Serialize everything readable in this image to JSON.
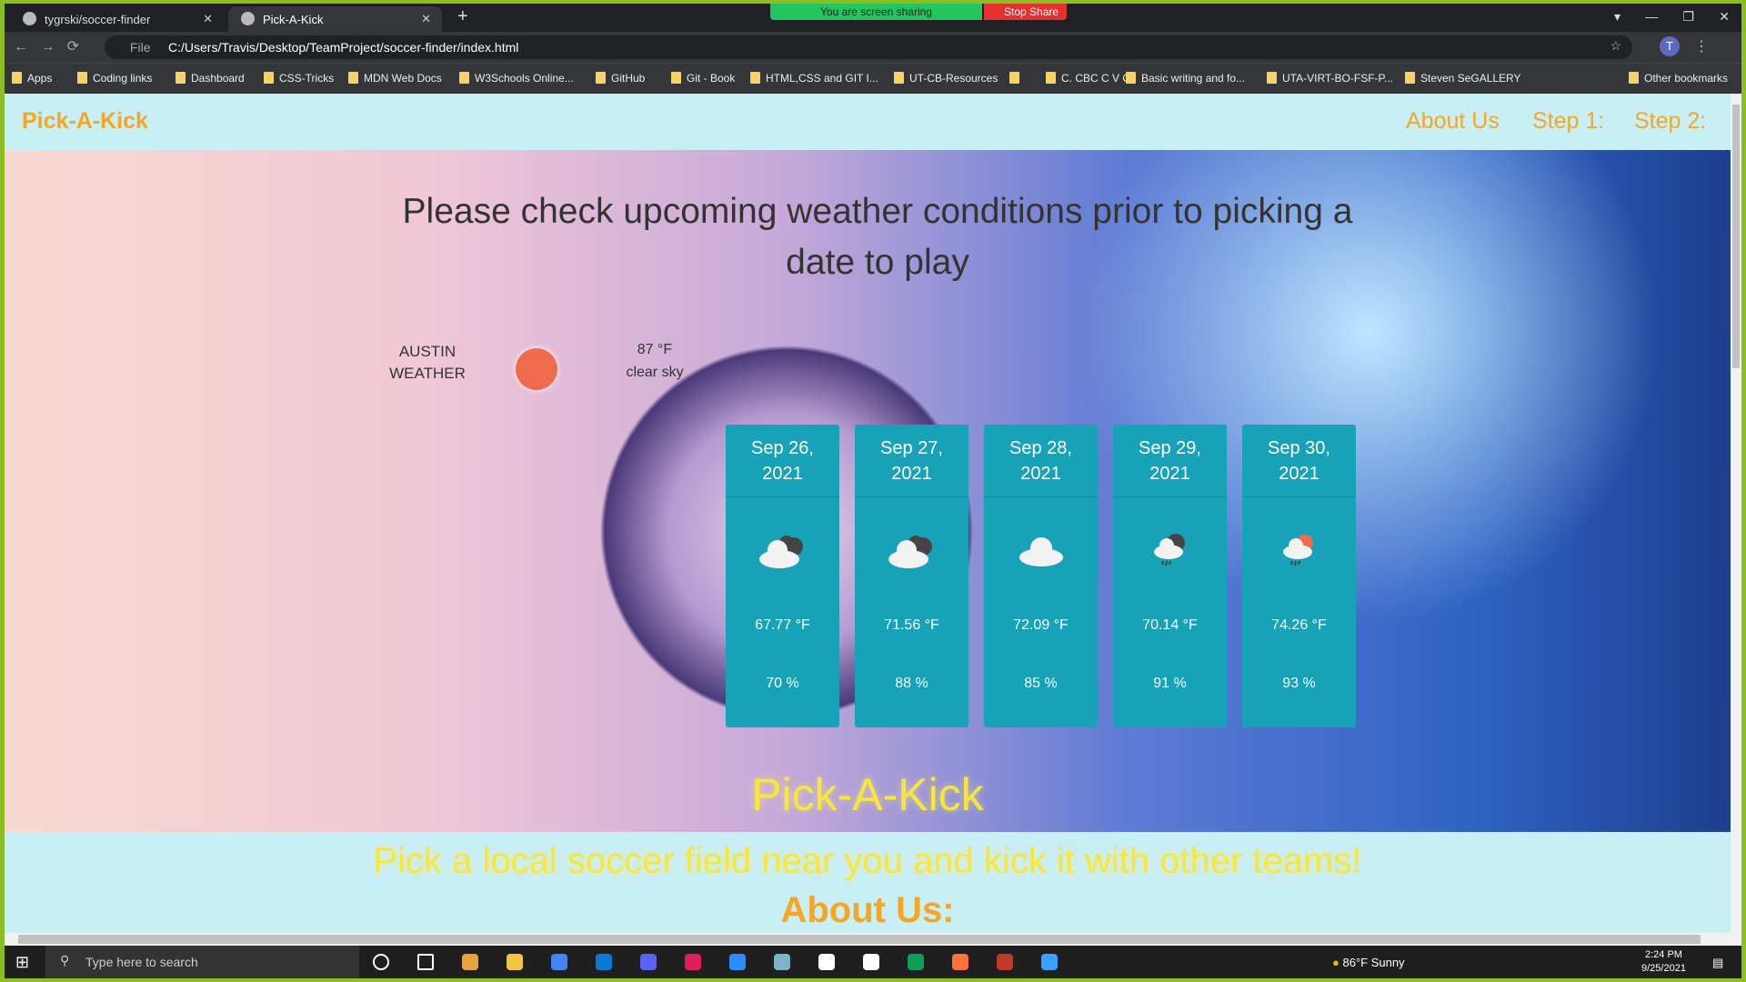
{
  "browser": {
    "tabs": [
      {
        "title": "tygrski/soccer-finder"
      },
      {
        "title": "Pick-A-Kick"
      }
    ],
    "share_banner": "You are screen sharing",
    "stop_share": "Stop Share",
    "url_scheme": "File",
    "url": "C:/Users/Travis/Desktop/TeamProject/soccer-finder/index.html",
    "bookmarks": [
      "Apps",
      "Coding links",
      "Dashboard",
      "CSS-Tricks",
      "MDN Web Docs",
      "W3Schools Online...",
      "GitHub",
      "Git - Book",
      "HTML,CSS and GIT I...",
      "UT-CB-Resources",
      "",
      "C. CBC C V C",
      "Basic writing and fo...",
      "UTA-VIRT-BO-FSF-P...",
      "Steven SeGALLERY"
    ],
    "other_bookmarks": "Other bookmarks",
    "profile_initial": "T"
  },
  "nav": {
    "brand": "Pick-A-Kick",
    "links": [
      "About Us",
      "Step 1:",
      "Step 2:"
    ]
  },
  "hero": {
    "heading": "Please check upcoming weather conditions prior to picking a date to play",
    "current": {
      "city_label": "AUSTIN WEATHER",
      "temp": "87 °F",
      "desc": "clear sky",
      "icon": "sun-icon",
      "icon_color": "#ee6c4d"
    },
    "forecast": [
      {
        "date": "Sep 26, 2021",
        "icon": "cloudy-dark-icon",
        "temp": "67.77 °F",
        "humidity": "70 %"
      },
      {
        "date": "Sep 27, 2021",
        "icon": "cloudy-dark-icon",
        "temp": "71.56 °F",
        "humidity": "88 %"
      },
      {
        "date": "Sep 28, 2021",
        "icon": "cloud-icon",
        "temp": "72.09 °F",
        "humidity": "85 %"
      },
      {
        "date": "Sep 29, 2021",
        "icon": "rain-night-icon",
        "temp": "70.14 °F",
        "humidity": "91 %"
      },
      {
        "date": "Sep 30, 2021",
        "icon": "rain-sun-icon",
        "temp": "74.26 °F",
        "humidity": "93 %"
      }
    ],
    "title": "Pick-A-Kick",
    "subtitle": "Pick a local soccer field near you and kick it with other teams!"
  },
  "about": {
    "heading": "About Us:"
  },
  "taskbar": {
    "search_placeholder": "Type here to search",
    "weather": "86°F  Sunny",
    "time": "2:24 PM",
    "date": "9/25/2021"
  },
  "colors": {
    "card": "#17a2b8",
    "brand": "#f5a623",
    "hero_title": "#f7e63b",
    "page_bg": "#c8eef6"
  }
}
